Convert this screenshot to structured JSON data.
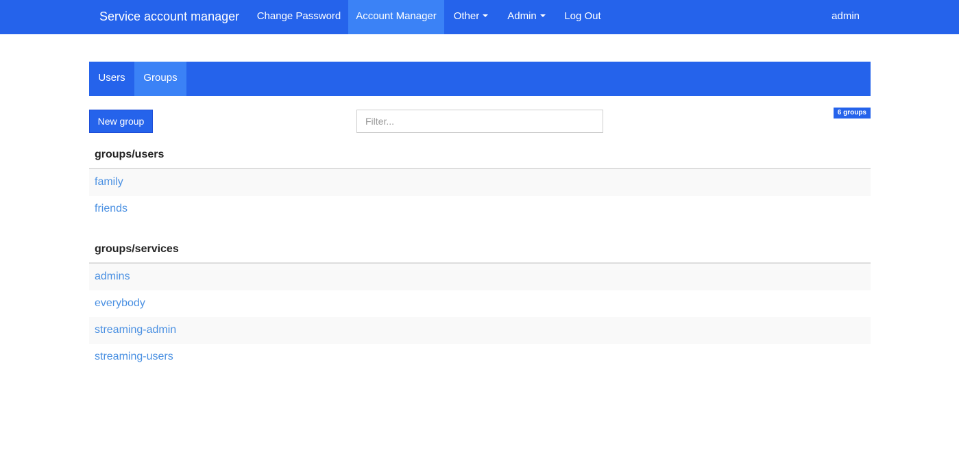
{
  "navbar": {
    "brand": "Service account manager",
    "items": [
      {
        "label": "Change Password",
        "active": false,
        "dropdown": false
      },
      {
        "label": "Account Manager",
        "active": true,
        "dropdown": false
      },
      {
        "label": "Other",
        "active": false,
        "dropdown": true
      },
      {
        "label": "Admin",
        "active": false,
        "dropdown": true
      },
      {
        "label": "Log Out",
        "active": false,
        "dropdown": false
      }
    ],
    "user": "admin"
  },
  "tabs": [
    {
      "label": "Users",
      "active": false
    },
    {
      "label": "Groups",
      "active": true
    }
  ],
  "toolbar": {
    "new_label": "New group",
    "filter_placeholder": "Filter...",
    "count_label": "6 groups"
  },
  "sections": [
    {
      "heading": "groups/users",
      "items": [
        "family",
        "friends"
      ]
    },
    {
      "heading": "groups/services",
      "items": [
        "admins",
        "everybody",
        "streaming-admin",
        "streaming-users"
      ]
    }
  ],
  "colors": {
    "primary": "#2563eb",
    "active": "#3b82f6",
    "link": "#4a90e2"
  }
}
